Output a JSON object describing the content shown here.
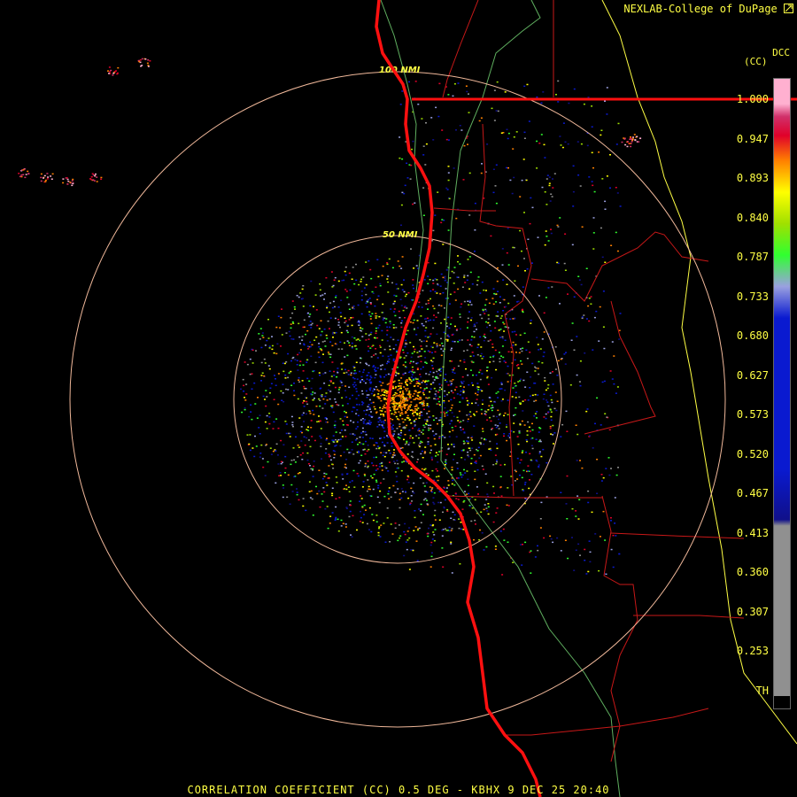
{
  "product": {
    "credit": "NEXLAB-College of DuPage",
    "code": "DCC",
    "unit": "(CC)",
    "footer": "CORRELATION COEFFICIENT (CC) 0.5 DEG - KBHX 9 DEC 25 20:40"
  },
  "range_rings": [
    "100 NMI",
    "50 NMI"
  ],
  "colorbar": {
    "labels": [
      "1.000",
      "0.947",
      "0.893",
      "0.840",
      "0.787",
      "0.733",
      "0.680",
      "0.627",
      "0.573",
      "0.520",
      "0.467",
      "0.413",
      "0.360",
      "0.307",
      "0.253",
      "TH"
    ],
    "colors": {
      "high": "#ffb0d0",
      "magenta": "#d0306a",
      "red": "#e0002a",
      "orange": "#ff8000",
      "yellow": "#ffff00",
      "ygreen": "#a0e000",
      "green": "#30ff30",
      "lavender": "#9aa0e0",
      "blue": "#0a1ad0",
      "darkblue": "#10108a",
      "grey": "#909090",
      "black": "#000000"
    }
  },
  "map_colors": {
    "coastline": "#ff1010",
    "county": "#c81818",
    "state": "#ffff44",
    "terrain": "#60b060",
    "ring": "#f0b89a"
  }
}
